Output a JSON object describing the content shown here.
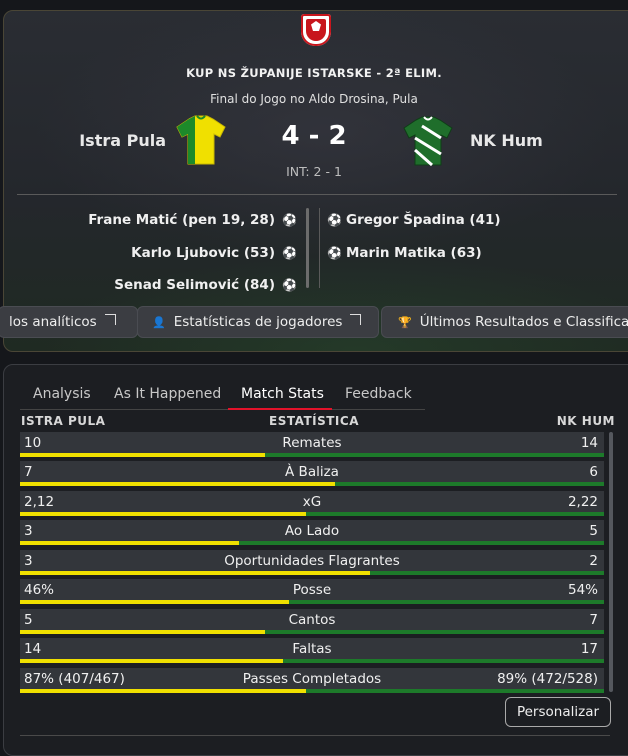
{
  "match": {
    "competition": "KUP NS ŽUPANIJE ISTARSKE - 2ª ELIM.",
    "venue": "Final do Jogo no Aldo Drosina, Pula",
    "home_team": "Istra Pula",
    "away_team": "NK Hum",
    "score": "4 - 2",
    "half_time": "INT: 2 - 1",
    "colors": {
      "home_kit": "#f0e000",
      "home_kit_stripe": "#1d8a2a",
      "away_kit": "#1f6e2b",
      "away_kit_stripe": "#ffffff"
    }
  },
  "goals": {
    "home": [
      "Frane Matić (pen 19, 28)",
      "Karlo Ljubovic (53)",
      "Senad Selimović (84)"
    ],
    "away": [
      "Gregor Špadina (41)",
      "Marin Matika (63)"
    ]
  },
  "buttons": {
    "analytics": "los analíticos",
    "player_stats": "Estatísticas de jogadores",
    "last_results": "Últimos Resultados e Classificaç"
  },
  "tabs": [
    "Analysis",
    "As It Happened",
    "Match Stats",
    "Feedback"
  ],
  "stats_header": {
    "home": "ISTRA PULA",
    "stat": "ESTATÍSTICA",
    "away": "NK HUM"
  },
  "stats": [
    {
      "home": "10",
      "label": "Remates",
      "away": "14",
      "home_share": 0.42
    },
    {
      "home": "7",
      "label": "À Baliza",
      "away": "6",
      "home_share": 0.54
    },
    {
      "home": "2,12",
      "label": "xG",
      "away": "2,22",
      "home_share": 0.49
    },
    {
      "home": "3",
      "label": "Ao Lado",
      "away": "5",
      "home_share": 0.375
    },
    {
      "home": "3",
      "label": "Oportunidades Flagrantes",
      "away": "2",
      "home_share": 0.6
    },
    {
      "home": "46%",
      "label": "Posse",
      "away": "54%",
      "home_share": 0.46
    },
    {
      "home": "5",
      "label": "Cantos",
      "away": "7",
      "home_share": 0.42
    },
    {
      "home": "14",
      "label": "Faltas",
      "away": "17",
      "home_share": 0.45
    },
    {
      "home": "87% (407/467)",
      "label": "Passes Completados",
      "away": "89% (472/528)",
      "home_share": 0.49
    }
  ],
  "customize": "Personalizar"
}
